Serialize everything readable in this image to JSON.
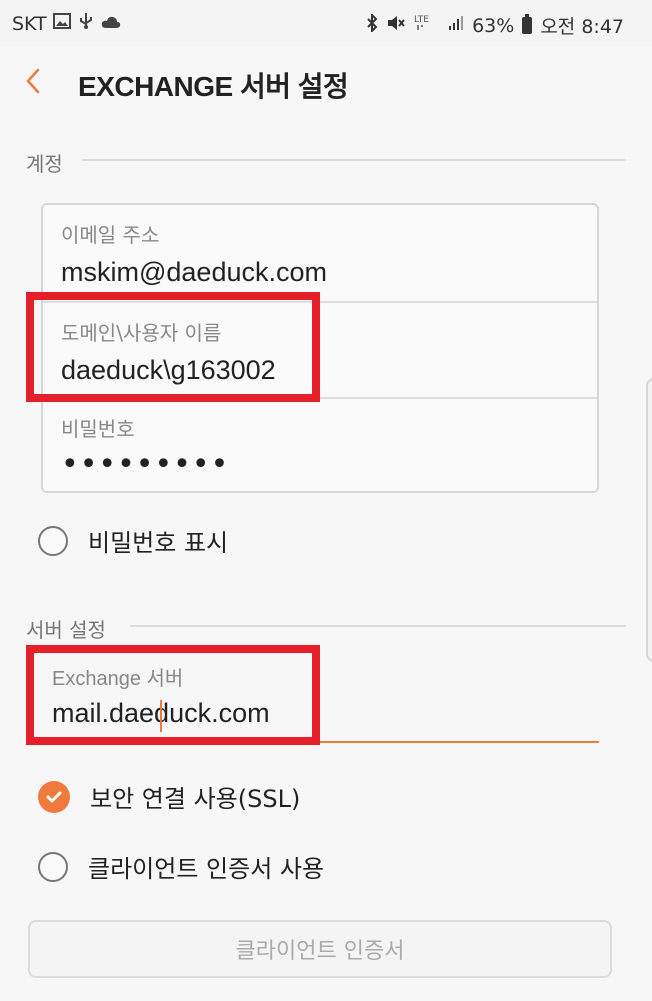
{
  "status_bar": {
    "carrier": "SKT",
    "left_icons": [
      "gallery-icon",
      "usb-icon",
      "cloud-icon"
    ],
    "right_icons": [
      "bluetooth-icon",
      "mute-icon",
      "lte-icon",
      "signal-icon"
    ],
    "battery": "63%",
    "time": "오전 8:47"
  },
  "app_bar": {
    "title": "EXCHANGE 서버 설정",
    "back_icon": "chevron-left-icon"
  },
  "account_section": {
    "label": "계정",
    "fields": [
      {
        "label": "이메일 주소",
        "value": "mskim@daeduck.com"
      },
      {
        "label": "도메인\\사용자 이름",
        "value": "daeduck\\g163002"
      },
      {
        "label": "비밀번호",
        "value": "•••••••••"
      }
    ],
    "show_password_label": "비밀번호 표시"
  },
  "server_section": {
    "label": "서버 설정",
    "server_field_label": "Exchange 서버",
    "server_field_value": "mail.daeduck.com",
    "ssl_label": "보안 연결 사용(SSL)",
    "ssl_checked": true,
    "client_cert_label": "클라이언트 인증서 사용",
    "client_cert_checked": false,
    "client_cert_button": "클라이언트 인증서"
  },
  "colors": {
    "accent": "#f07a3d",
    "highlight": "#e6202a"
  }
}
